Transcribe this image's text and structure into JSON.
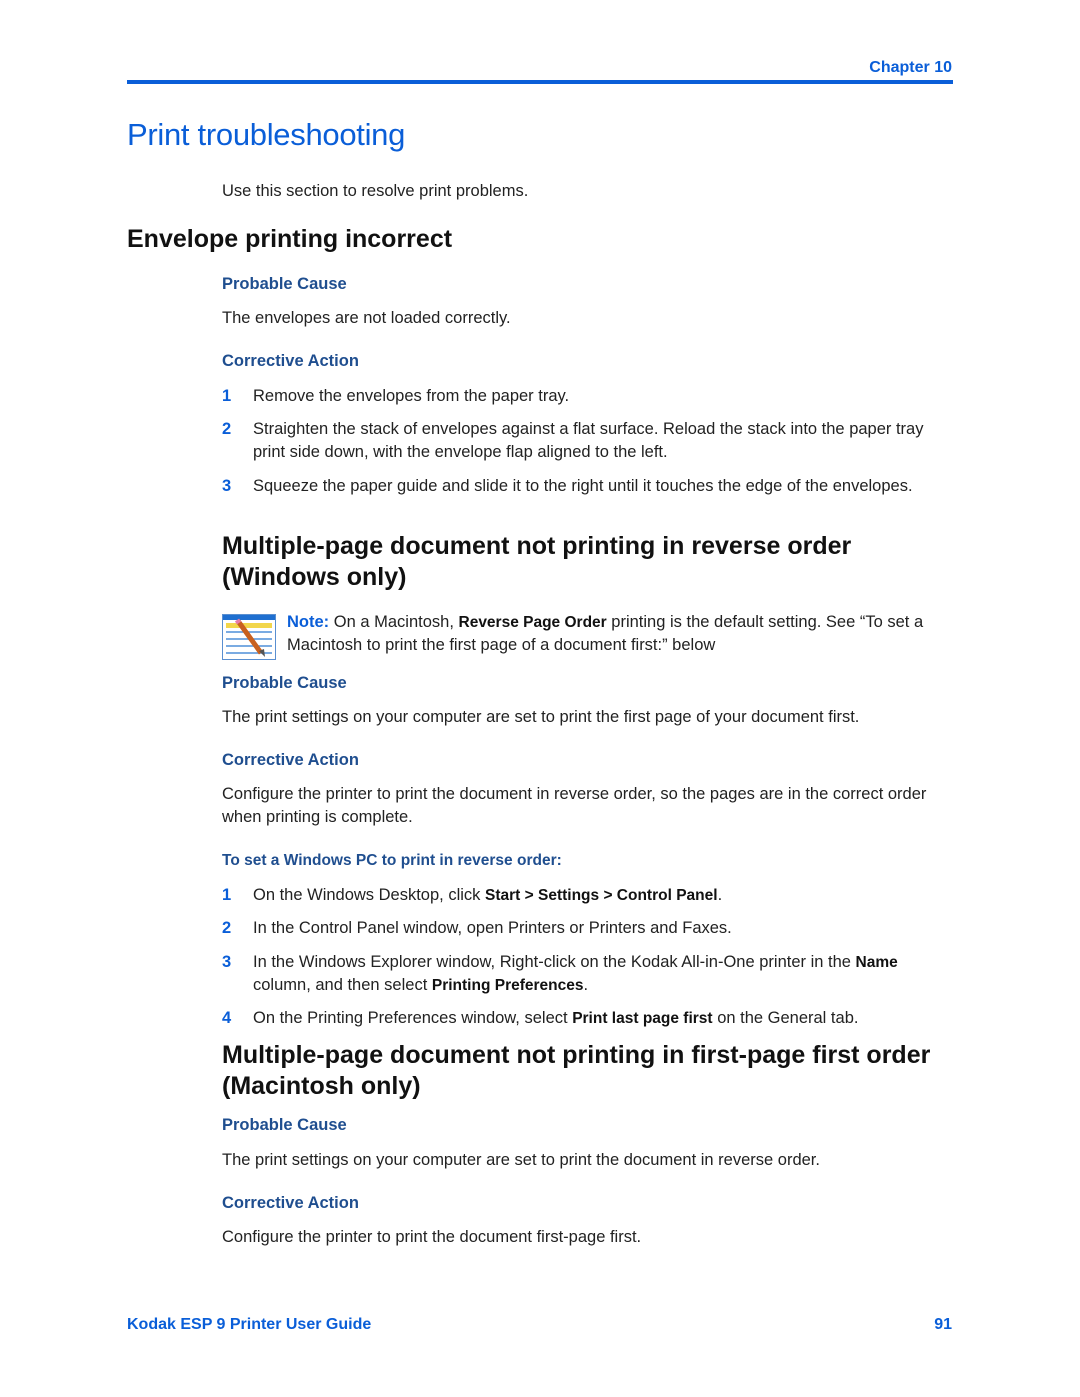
{
  "header": {
    "chapter": "Chapter 10"
  },
  "page_title": "Print troubleshooting",
  "intro": "Use this section to resolve print problems.",
  "sections": [
    {
      "heading": "Envelope printing incorrect",
      "cause_label": "Probable Cause",
      "cause": "The envelopes are not loaded correctly.",
      "action_label": "Corrective Action",
      "steps": [
        {
          "num": "1",
          "text": "Remove the envelopes from the paper tray."
        },
        {
          "num": "2",
          "text": "Straighten the stack of envelopes against a flat surface. Reload the stack into the paper tray print side down, with the envelope flap aligned to the left."
        },
        {
          "num": "3",
          "text": "Squeeze the paper guide and slide it to the right until it touches the edge of the envelopes."
        }
      ]
    },
    {
      "heading": "Multiple-page document not printing in reverse order (Windows only)",
      "note": {
        "label": "Note:",
        "pre": "On a Macintosh,",
        "bold": "Reverse Page Order",
        "post": "printing is the default setting. See “To set a Macintosh to print the first page of a document first:” below"
      },
      "cause_label": "Probable Cause",
      "cause": "The print settings on your computer are set to print the first page of your document first.",
      "action_label": "Corrective Action",
      "action": "Configure the printer to print the document in reverse order, so the pages are in the correct order when printing is complete.",
      "procedure_label": "To set a Windows PC to print in reverse order:",
      "steps": [
        {
          "num": "1",
          "pre": "On the Windows Desktop, click",
          "b1": "Start > Settings > Control Panel",
          "post": "."
        },
        {
          "num": "2",
          "text": "In the Control Panel window, open Printers or Printers and Faxes."
        },
        {
          "num": "3",
          "pre": "In the Windows Explorer window, Right-click on the Kodak All-in-One printer in the",
          "b1": "Name",
          "mid": "column, and then select",
          "b2": "Printing Preferences",
          "post": "."
        },
        {
          "num": "4",
          "pre": "On the Printing Preferences window, select",
          "b1": "Print last page first",
          "post": "on the General tab."
        }
      ]
    },
    {
      "heading": "Multiple-page document not printing in first-page first order (Macintosh only)",
      "cause_label": "Probable Cause",
      "cause": "The print settings on your computer are set to print the document in reverse order.",
      "action_label": "Corrective Action",
      "action": "Configure the printer to print the document first-page first."
    }
  ],
  "footer": {
    "guide_title": "Kodak ESP 9 Printer User Guide",
    "page_number": "91"
  }
}
